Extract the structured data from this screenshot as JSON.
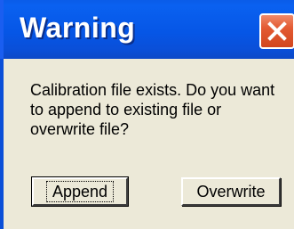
{
  "window": {
    "title": "Warning",
    "close_icon": "close-icon",
    "colors": {
      "titlebar": "#0a5ce8",
      "close_button": "#e35a32",
      "background": "#ece9d8"
    }
  },
  "dialog": {
    "message": "Calibration file exists.  Do you want to append to existing file or overwrite file?"
  },
  "buttons": {
    "append_label": "Append",
    "overwrite_label": "Overwrite"
  }
}
